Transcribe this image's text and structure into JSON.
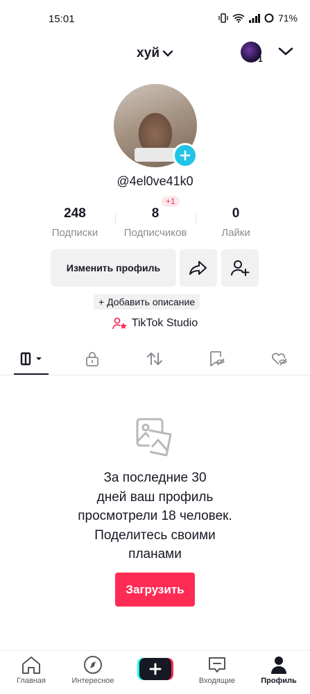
{
  "status_bar": {
    "time": "15:01",
    "battery": "71%"
  },
  "header": {
    "username": "хуй",
    "notification_count": "1"
  },
  "profile": {
    "handle": "@4el0ve41k0",
    "stats": [
      {
        "value": "248",
        "label": "Подписки"
      },
      {
        "value": "8",
        "label": "Подписчиков",
        "badge": "+1"
      },
      {
        "value": "0",
        "label": "Лайки"
      }
    ],
    "edit_button": "Изменить профиль",
    "add_description": "+ Добавить описание",
    "studio": "TikTok Studio"
  },
  "empty_state": {
    "lines": [
      "За последние 30",
      "дней ваш профиль",
      "просмотрели 18 человек.",
      "Поделитесь своими",
      "планами"
    ],
    "button": "Загрузить"
  },
  "bottom_nav": {
    "items": [
      {
        "label": "Главная",
        "icon": "home-icon"
      },
      {
        "label": "Интересное",
        "icon": "compass-icon"
      },
      {
        "label": "",
        "icon": "plus-icon"
      },
      {
        "label": "Входящие",
        "icon": "inbox-icon"
      },
      {
        "label": "Профиль",
        "icon": "profile-icon",
        "active": true
      }
    ]
  },
  "colors": {
    "accent": "#fe2c55",
    "plus_badge": "#20c4e6",
    "text": "#161823",
    "muted": "#8a8b91"
  }
}
